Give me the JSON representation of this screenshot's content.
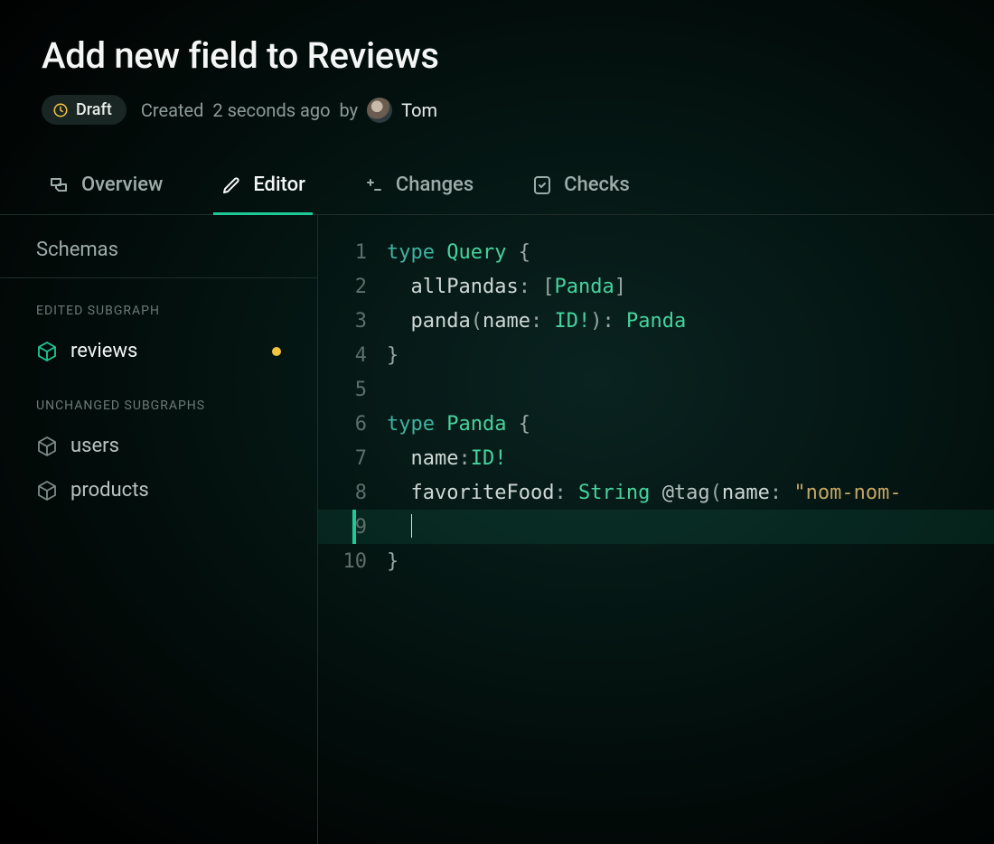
{
  "header": {
    "title": "Add new field to Reviews",
    "badge": "Draft",
    "created_prefix": "Created",
    "created_time": "2 seconds ago",
    "created_by": "by",
    "author": "Tom"
  },
  "tabs": [
    {
      "id": "overview",
      "label": "Overview",
      "active": false
    },
    {
      "id": "editor",
      "label": "Editor",
      "active": true
    },
    {
      "id": "changes",
      "label": "Changes",
      "active": false
    },
    {
      "id": "checks",
      "label": "Checks",
      "active": false
    }
  ],
  "sidebar": {
    "title": "Schemas",
    "edited_label": "EDITED SUBGRAPH",
    "unchanged_label": "UNCHANGED SUBGRAPHS",
    "edited": [
      {
        "name": "reviews",
        "dirty": true
      }
    ],
    "unchanged": [
      {
        "name": "users"
      },
      {
        "name": "products"
      }
    ]
  },
  "editor": {
    "highlighted_line": 9,
    "lines": [
      {
        "n": 1,
        "tokens": [
          [
            "kw",
            "type"
          ],
          [
            "",
            ""
          ],
          [
            "tn",
            "Query"
          ],
          [
            "",
            " "
          ],
          [
            "pun",
            "{"
          ]
        ]
      },
      {
        "n": 2,
        "tokens": [
          [
            "",
            "  "
          ],
          [
            "fld",
            "allPandas"
          ],
          [
            "pun",
            ":"
          ],
          [
            "",
            " "
          ],
          [
            "pun",
            "["
          ],
          [
            "ty2",
            "Panda"
          ],
          [
            "pun",
            "]"
          ]
        ]
      },
      {
        "n": 3,
        "tokens": [
          [
            "",
            "  "
          ],
          [
            "fld",
            "panda"
          ],
          [
            "pun",
            "("
          ],
          [
            "fld",
            "name"
          ],
          [
            "pun",
            ":"
          ],
          [
            "",
            " "
          ],
          [
            "ty2",
            "ID!"
          ],
          [
            "pun",
            ")"
          ],
          [
            "pun",
            ":"
          ],
          [
            "",
            " "
          ],
          [
            "ty2",
            "Panda"
          ]
        ]
      },
      {
        "n": 4,
        "tokens": [
          [
            "pun",
            "}"
          ]
        ]
      },
      {
        "n": 5,
        "tokens": [
          [
            "",
            ""
          ]
        ]
      },
      {
        "n": 6,
        "tokens": [
          [
            "kw",
            "type"
          ],
          [
            "",
            ""
          ],
          [
            "tn",
            "Panda"
          ],
          [
            "",
            " "
          ],
          [
            "pun",
            "{"
          ]
        ]
      },
      {
        "n": 7,
        "tokens": [
          [
            "",
            "  "
          ],
          [
            "fld",
            "name"
          ],
          [
            "pun",
            ":"
          ],
          [
            "ty2",
            "ID!"
          ]
        ]
      },
      {
        "n": 8,
        "tokens": [
          [
            "",
            "  "
          ],
          [
            "fld",
            "favoriteFood"
          ],
          [
            "pun",
            ":"
          ],
          [
            "",
            " "
          ],
          [
            "ty2",
            "String"
          ],
          [
            "",
            " "
          ],
          [
            "dir",
            "@tag"
          ],
          [
            "pun",
            "("
          ],
          [
            "fld",
            "name"
          ],
          [
            "pun",
            ":"
          ],
          [
            "",
            " "
          ],
          [
            "str",
            "\"nom-nom-"
          ]
        ]
      },
      {
        "n": 9,
        "tokens": [
          [
            "",
            "  "
          ]
        ],
        "cursor": true
      },
      {
        "n": 10,
        "tokens": [
          [
            "pun",
            "}"
          ]
        ]
      }
    ]
  }
}
